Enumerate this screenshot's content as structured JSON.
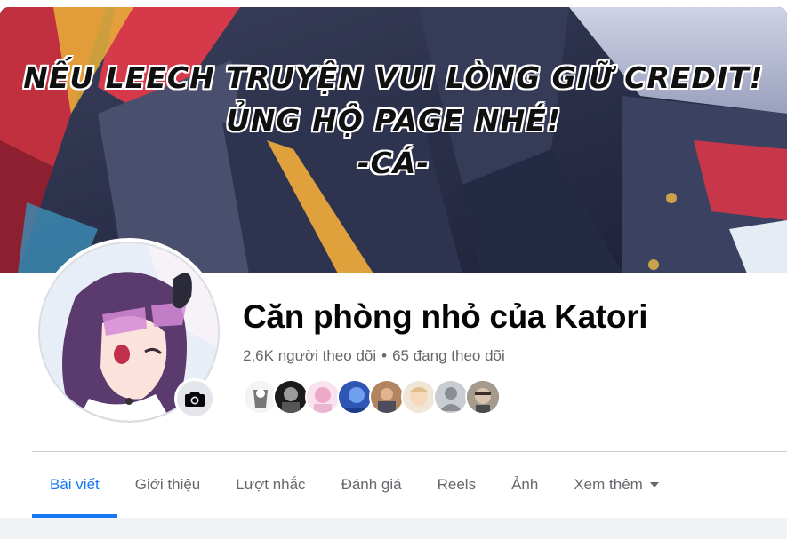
{
  "cover": {
    "lines": [
      "NẾU LEECH TRUYỆN VUI LÒNG GIỮ CREDIT!",
      "ỦNG HỘ PAGE NHÉ!",
      "-CÁ-"
    ]
  },
  "profile": {
    "name": "Căn phòng nhỏ của Katori",
    "followers": "2,6K người theo dõi",
    "separator": "•",
    "following": "65 đang theo dõi"
  },
  "friend_avatars": [
    "avatar-1",
    "avatar-2",
    "avatar-3",
    "avatar-4",
    "avatar-5",
    "avatar-6",
    "avatar-7",
    "avatar-8"
  ],
  "tabs": [
    {
      "label": "Bài viết",
      "active": true
    },
    {
      "label": "Giới thiệu"
    },
    {
      "label": "Lượt nhắc"
    },
    {
      "label": "Đánh giá"
    },
    {
      "label": "Reels"
    },
    {
      "label": "Ảnh"
    },
    {
      "label": "Xem thêm"
    }
  ],
  "colors": {
    "accent": "#1877f2",
    "secondary_text": "#65676b",
    "primary_text": "#050505",
    "background": "#f0f2f5"
  },
  "icons": {
    "camera": "camera-icon",
    "more": "caret-down-icon"
  }
}
